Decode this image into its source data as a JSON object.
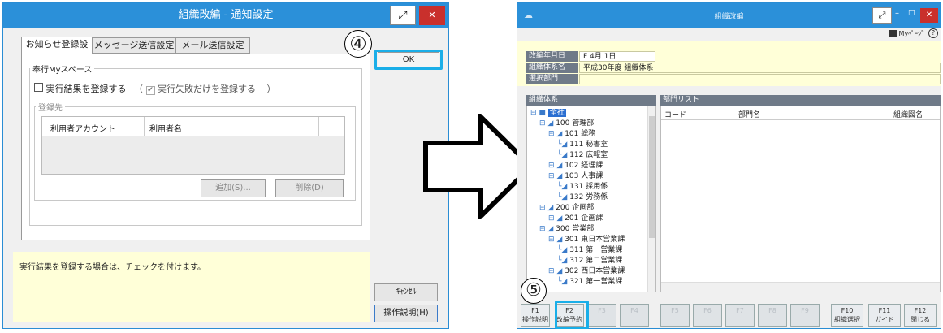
{
  "left_dialog": {
    "title": "組織改編 - 通知設定",
    "tabs": [
      "お知らせ登録設定",
      "メッセージ送信設定",
      "メール送信設定"
    ],
    "section_label": "奉行Myスペース",
    "register_checkbox_label": "実行結果を登録する",
    "paren_open": "（",
    "paren_close": "）",
    "failed_only_label": "実行失敗だけを登録する",
    "destination_label": "登録先",
    "table_headers": [
      "利用者アカウント",
      "利用者名"
    ],
    "add_button": "追加(S)...",
    "delete_button": "削除(D)",
    "ok_button": "OK",
    "cancel_button": "ｷｬﾝｾﾙ",
    "help_button": "操作説明(H)",
    "hint_text": "実行結果を登録する場合は、チェックを付けます。",
    "step_marker": "④"
  },
  "right_app": {
    "title": "組織改編",
    "mypage_label": "Myﾍﾟｰｼﾞ",
    "help_symbol": "?",
    "fields": [
      {
        "label": "改編年月日",
        "value": "F  4月  1日"
      },
      {
        "label": "組織体系名",
        "value": "平成30年度 組織体系"
      },
      {
        "label": "選択部門",
        "value": ""
      }
    ],
    "tree_header": "組織体系",
    "list_header": "部門リスト",
    "list_columns": [
      "コード",
      "部門名",
      "組織図名"
    ],
    "tree_items": [
      {
        "text": "全社",
        "level": 0,
        "selected": true
      },
      {
        "text": "100 管理部",
        "level": 1
      },
      {
        "text": "101 総務",
        "level": 2
      },
      {
        "text": "111 秘書室",
        "level": 3
      },
      {
        "text": "112 広報室",
        "level": 3
      },
      {
        "text": "102 経理課",
        "level": 2
      },
      {
        "text": "103 人事課",
        "level": 2
      },
      {
        "text": "131 採用係",
        "level": 3
      },
      {
        "text": "132 労務係",
        "level": 3
      },
      {
        "text": "200 企画部",
        "level": 1
      },
      {
        "text": "201 企画課",
        "level": 2
      },
      {
        "text": "300 営業部",
        "level": 1
      },
      {
        "text": "301 東日本営業課",
        "level": 2
      },
      {
        "text": "311 第一営業課",
        "level": 3
      },
      {
        "text": "312 第二営業課",
        "level": 3
      },
      {
        "text": "302 西日本営業課",
        "level": 2
      },
      {
        "text": "321 第一営業課",
        "level": 3
      }
    ],
    "fkeys": [
      {
        "key": "F1",
        "label": "操作説明",
        "dim": false
      },
      {
        "key": "F2",
        "label": "改編予約",
        "dim": false
      },
      {
        "key": "F3",
        "label": "",
        "dim": true
      },
      {
        "key": "F4",
        "label": "",
        "dim": true
      },
      {
        "key": "F5",
        "label": "",
        "dim": true
      },
      {
        "key": "F6",
        "label": "",
        "dim": true
      },
      {
        "key": "F7",
        "label": "",
        "dim": true
      },
      {
        "key": "F8",
        "label": "",
        "dim": true
      },
      {
        "key": "F9",
        "label": "",
        "dim": true
      },
      {
        "key": "F10",
        "label": "組織選択",
        "dim": false
      },
      {
        "key": "F11",
        "label": "ガイド",
        "dim": false
      },
      {
        "key": "F12",
        "label": "閉じる",
        "dim": false
      }
    ],
    "step_marker": "⑤"
  },
  "colors": {
    "titlebar": "#2b90d9",
    "highlight": "#1aaee8",
    "hint_bg": "#ffffd8",
    "close": "#c9302c"
  }
}
